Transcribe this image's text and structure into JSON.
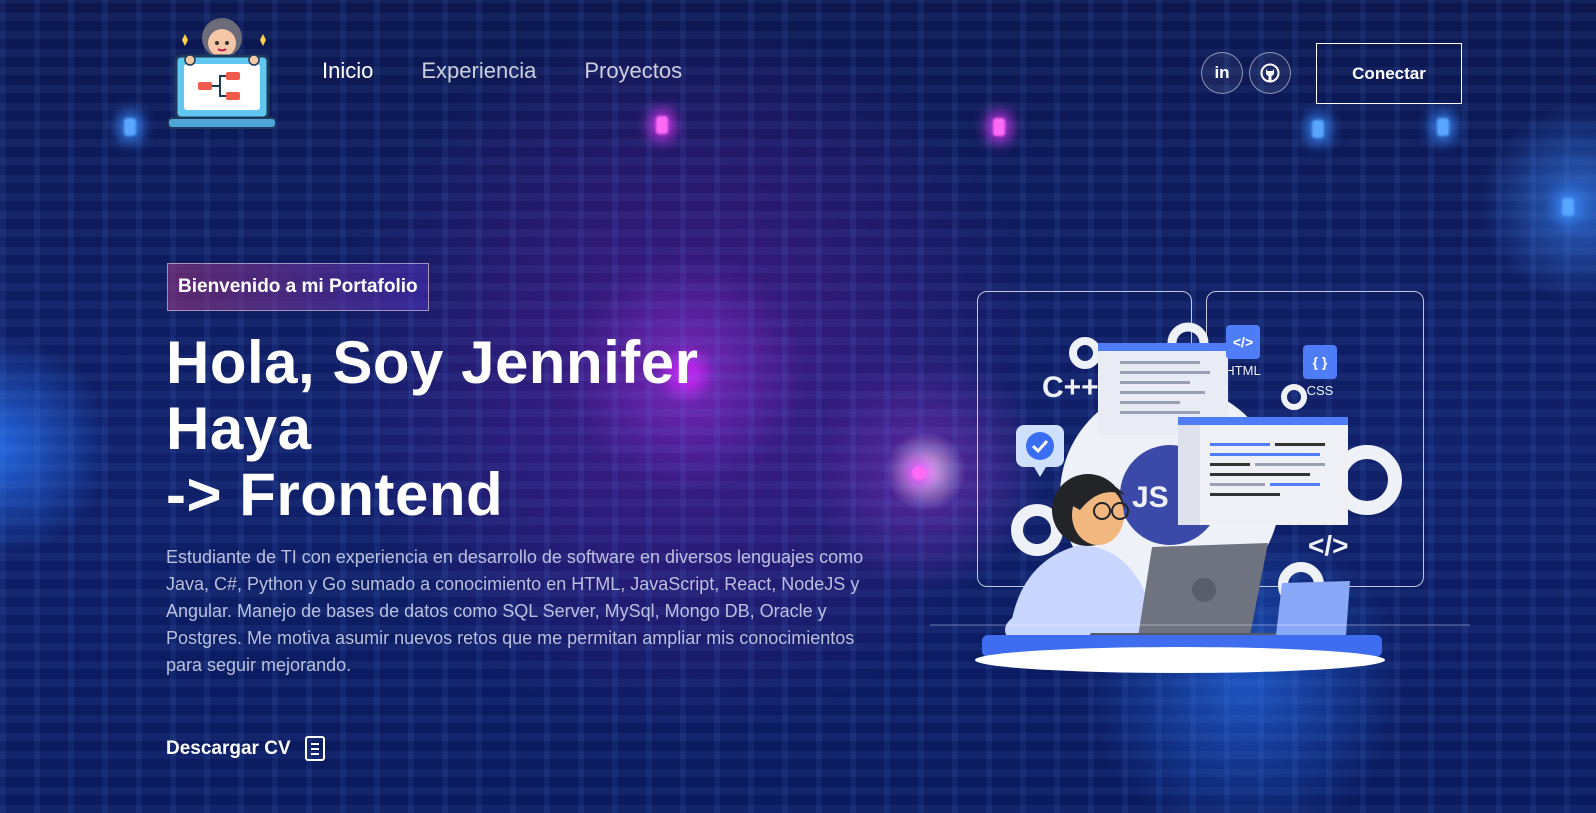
{
  "nav": {
    "links": [
      {
        "label": "Inicio"
      },
      {
        "label": "Experiencia"
      },
      {
        "label": "Proyectos"
      }
    ],
    "social": {
      "linkedin": "in",
      "github_icon": "github-icon"
    },
    "connect_label": "Conectar"
  },
  "hero": {
    "tagline": "Bienvenido a mi Portafolio",
    "headline": {
      "line1": "Hola, Soy Jennifer",
      "line2": "Haya",
      "line3": "-> Frontend"
    },
    "description": "Estudiante de TI con experiencia en desarrollo de software en diversos lenguajes como Java, C#, Python y Go sumado a conocimiento en HTML, JavaScript, React, NodeJS y Angular. Manejo de bases de datos como SQL Server, MySql, Mongo DB, Oracle y Postgres. Me motiva asumir nuevos retos que me permitan ampliar mis conocimientos para seguir mejorando.",
    "cv_label": "Descargar CV"
  },
  "illustration": {
    "labels": {
      "cpp": "C++",
      "html": "HTML",
      "css": "CSS",
      "js": "JS",
      "code_tag": "</>",
      "html_tag": "</>",
      "css_braces": "{ }"
    }
  },
  "colors": {
    "background": "#0a1450",
    "accent_pink": "#d82cff",
    "accent_blue": "#3a7bff",
    "illus_blue": "#4f7cf7"
  }
}
